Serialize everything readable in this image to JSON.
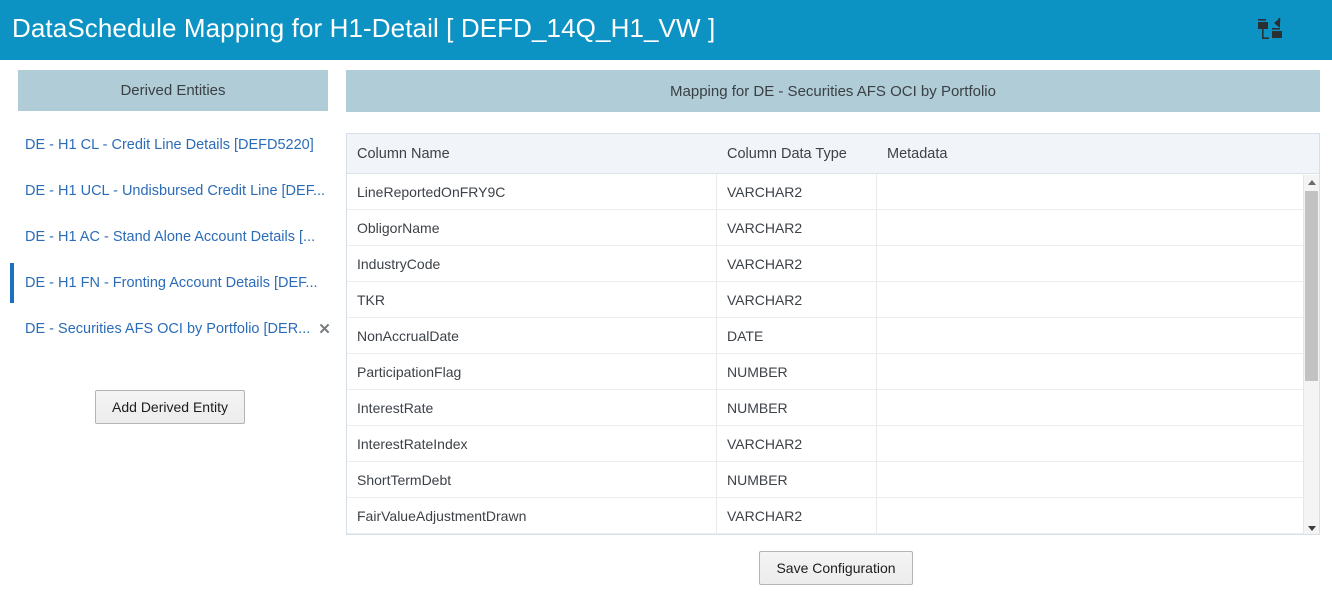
{
  "header": {
    "title": "DataSchedule Mapping for H1-Detail [ DEFD_14Q_H1_VW ]",
    "icon": "hierarchy-icon",
    "background_color": "#0c93c3",
    "text_color": "#ffffff"
  },
  "sidebar": {
    "panel_title": "Derived Entities",
    "panel_header_color": "#b0ccd7",
    "link_color": "#2b6cb8",
    "active_accent_color": "#1b6fc4",
    "items": [
      {
        "label": "DE - H1 CL - Credit Line Details [DEFD5220]",
        "active": false,
        "closable": false
      },
      {
        "label": "DE - H1 UCL - Undisbursed Credit Line [DEF...",
        "active": false,
        "closable": false
      },
      {
        "label": "DE - H1 AC - Stand Alone Account Details [...",
        "active": false,
        "closable": false
      },
      {
        "label": "DE - H1 FN - Fronting Account Details [DEF...",
        "active": true,
        "closable": false
      },
      {
        "label": "DE - Securities AFS OCI by Portfolio [DER...",
        "active": false,
        "closable": true
      }
    ],
    "close_glyph": "✕",
    "add_button_label": "Add Derived Entity"
  },
  "main": {
    "panel_title": "Mapping for DE - Securities AFS OCI by Portfolio",
    "panel_header_color": "#b0ccd7",
    "table": {
      "columns": [
        "Column Name",
        "Column Data Type",
        "Metadata"
      ],
      "rows": [
        {
          "column_name": "LineReportedOnFRY9C",
          "data_type": "VARCHAR2",
          "metadata": ""
        },
        {
          "column_name": "ObligorName",
          "data_type": "VARCHAR2",
          "metadata": ""
        },
        {
          "column_name": "IndustryCode",
          "data_type": "VARCHAR2",
          "metadata": ""
        },
        {
          "column_name": "TKR",
          "data_type": "VARCHAR2",
          "metadata": ""
        },
        {
          "column_name": "NonAccrualDate",
          "data_type": "DATE",
          "metadata": ""
        },
        {
          "column_name": "ParticipationFlag",
          "data_type": "NUMBER",
          "metadata": ""
        },
        {
          "column_name": "InterestRate",
          "data_type": "NUMBER",
          "metadata": ""
        },
        {
          "column_name": "InterestRateIndex",
          "data_type": "VARCHAR2",
          "metadata": ""
        },
        {
          "column_name": "ShortTermDebt",
          "data_type": "NUMBER",
          "metadata": ""
        },
        {
          "column_name": "FairValueAdjustmentDrawn",
          "data_type": "VARCHAR2",
          "metadata": ""
        }
      ]
    },
    "scrollbar": {
      "up_arrow": "scroll-up-arrow",
      "down_arrow": "scroll-down-arrow"
    }
  },
  "footer": {
    "save_button_label": "Save Configuration"
  }
}
